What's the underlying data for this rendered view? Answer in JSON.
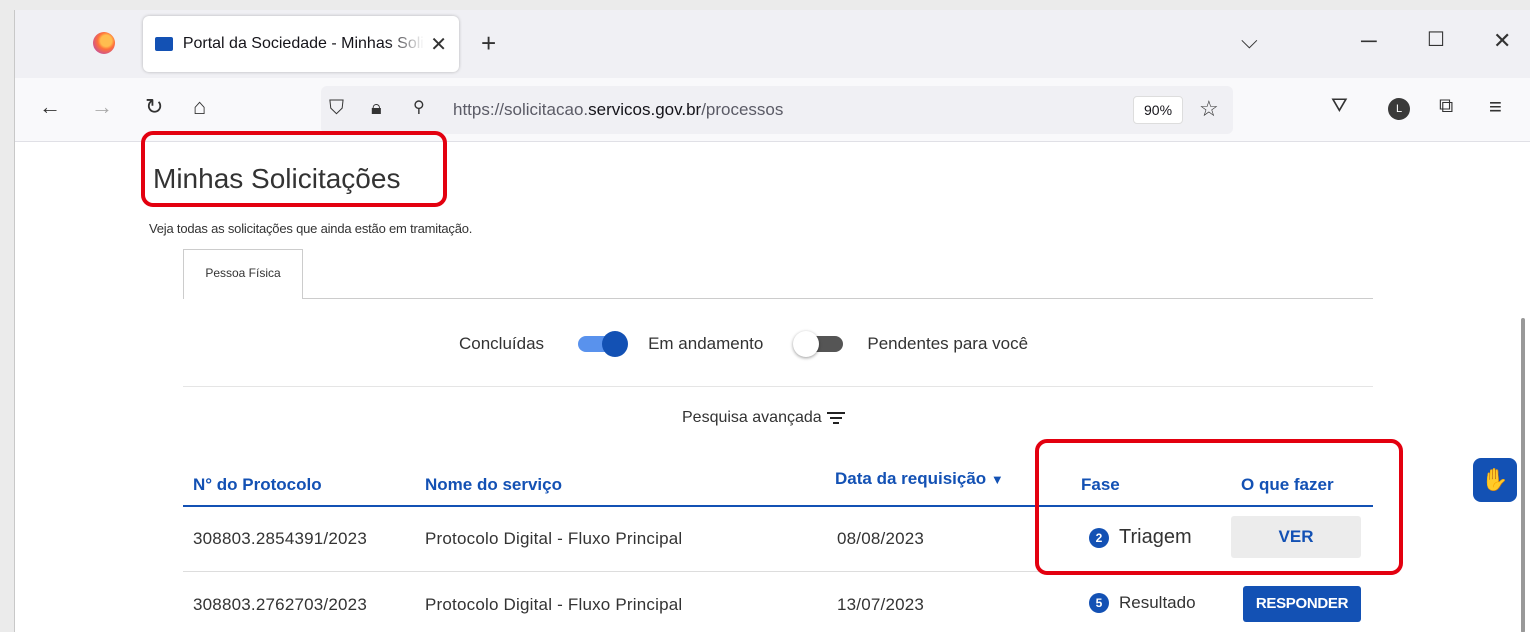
{
  "browser": {
    "tab_title": "Portal da Sociedade - Minhas Solicitações",
    "new_tab_symbol": "+",
    "tab_list_symbol": "⌵",
    "url_prefix": "https://solicitacao.",
    "url_domain": "servicos.gov.br",
    "url_path": "/processos",
    "zoom": "90%",
    "profile_initial": "L",
    "icons": [
      "firefox-icon",
      "close-tab-icon",
      "back-icon",
      "forward-icon",
      "reload-icon",
      "home-icon",
      "shield-icon",
      "lock-icon",
      "permissions-icon",
      "bookmark-star-icon",
      "pocket-icon",
      "account-icon",
      "extensions-icon",
      "menu-icon",
      "minimize-icon",
      "maximize-icon",
      "close-window-icon"
    ]
  },
  "page": {
    "title": "Minhas Solicitações",
    "subtitle": "Veja todas as solicitações que ainda estão em tramitação.",
    "tab_label": "Pessoa Física",
    "toggle_label_left": "Concluídas",
    "toggle_label_middle": "Em andamento",
    "toggle_label_right": "Pendentes para você",
    "toggle_concluidas_em_andamento": "on",
    "toggle_pendentes": "off",
    "advanced_search": "Pesquisa avançada"
  },
  "table": {
    "headers": [
      "N° do Protocolo",
      "Nome do serviço",
      "Data da requisição",
      "Fase",
      "O que fazer"
    ],
    "rows": [
      {
        "protocolo": "308803.2854391/2023",
        "servico": "Protocolo Digital - Fluxo Principal",
        "data": "08/08/2023",
        "fase_num": "2",
        "fase": "Triagem",
        "acao": "VER"
      },
      {
        "protocolo": "308803.2762703/2023",
        "servico": "Protocolo Digital - Fluxo Principal",
        "data": "13/07/2023",
        "fase_num": "5",
        "fase": "Resultado",
        "acao": "RESPONDER"
      }
    ]
  },
  "colors": {
    "accent": "#1351b4",
    "highlight": "#e3000f"
  }
}
